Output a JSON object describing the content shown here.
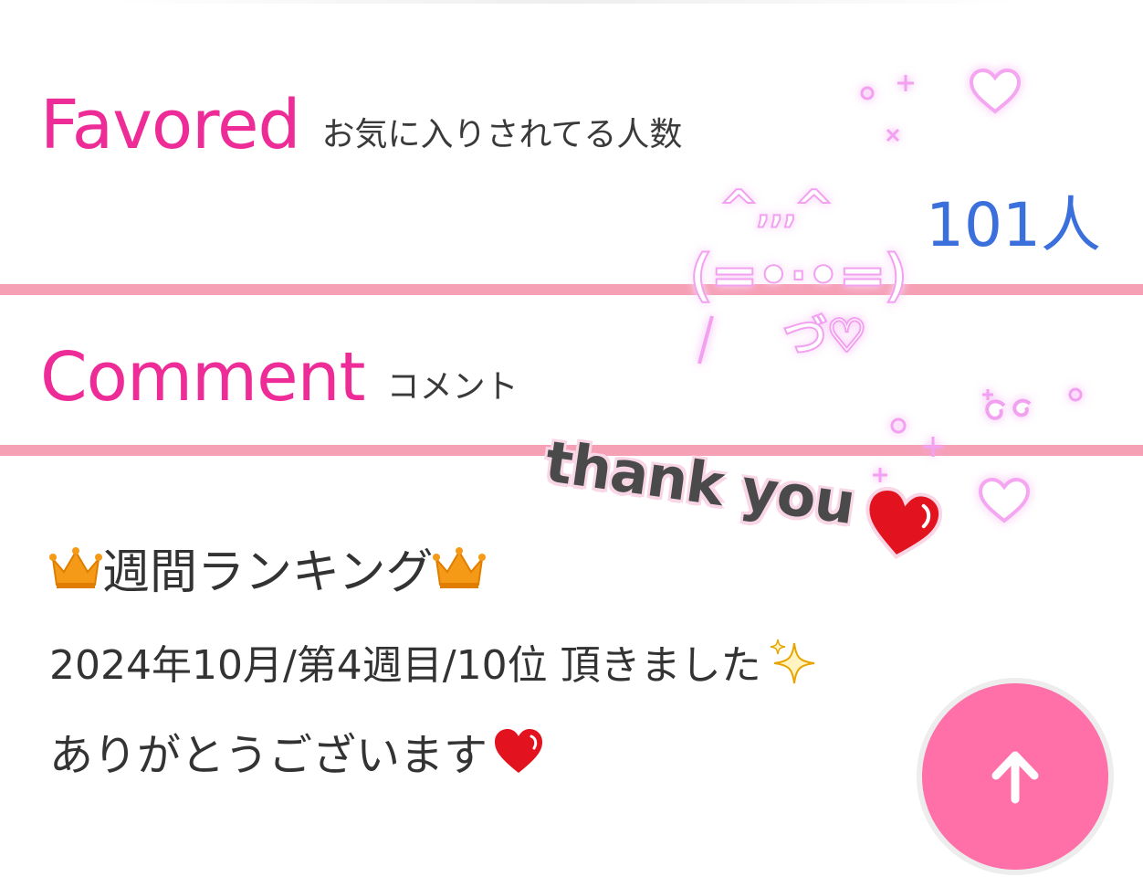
{
  "favored": {
    "title": "Favored",
    "subtitle": "お気に入りされてる人数",
    "count": "101人"
  },
  "comment": {
    "title": "Comment",
    "subtitle": "コメント",
    "lines": [
      "週間ランキング",
      "2024年10月/第4週目/10位 頂きました",
      "ありがとうございます"
    ]
  },
  "decoration": {
    "thank_you": "thank you",
    "kaomoji_ears": "^,,,^",
    "kaomoji_face": "(=•·•=)",
    "kaomoji_paw": "づ♡"
  },
  "icons": [
    "crown-icon",
    "sparkle-icon",
    "heart-icon",
    "arrow-up-icon"
  ],
  "colors": {
    "accent_pink": "#ee2c97",
    "count_blue": "#3b6fdc",
    "divider_pink": "#f6a0b5",
    "fab_pink": "#ff6fa8"
  }
}
